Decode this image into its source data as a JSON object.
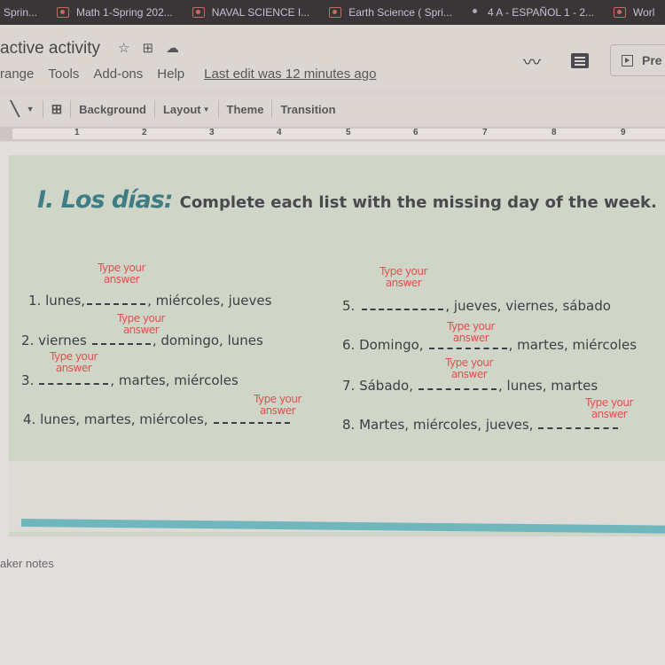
{
  "browser_tabs": [
    {
      "label": "Sprin...",
      "icon": "none"
    },
    {
      "label": "Math 1-Spring 202...",
      "icon": "classroom-icon"
    },
    {
      "label": "NAVAL SCIENCE I...",
      "icon": "classroom-icon"
    },
    {
      "label": "Earth Science ( Spri...",
      "icon": "classroom-icon"
    },
    {
      "label": "4 A - ESPAÑOL 1 - 2...",
      "icon": "person-icon"
    },
    {
      "label": "Worl",
      "icon": "classroom-icon"
    }
  ],
  "document": {
    "title": "active activity",
    "menu": [
      "range",
      "Tools",
      "Add-ons",
      "Help"
    ],
    "last_edit": "Last edit was 12 minutes ago",
    "present_label": "Pre"
  },
  "toolbar": {
    "background": "Background",
    "layout": "Layout",
    "theme": "Theme",
    "transition": "Transition"
  },
  "ruler": [
    "1",
    "2",
    "3",
    "4",
    "5",
    "6",
    "7",
    "8",
    "9"
  ],
  "slide": {
    "title": "I. Los días:",
    "instruction": "Complete each list with the missing day of the week.",
    "hint": "Type your answer",
    "items": [
      {
        "before": "1. lunes,",
        "after": ", miércoles, jueves"
      },
      {
        "before": "2. viernes",
        "after": ", domingo, lunes"
      },
      {
        "before": "3.",
        "after": ", martes, miércoles"
      },
      {
        "before": "4. lunes, martes, miércoles,",
        "after": ""
      },
      {
        "before": "5.",
        "after": ", jueves, viernes, sábado"
      },
      {
        "before": "6. Domingo,",
        "after": ", martes, miércoles"
      },
      {
        "before": "7. Sábado,",
        "after": ", lunes, martes"
      },
      {
        "before": "8. Martes, miércoles, jueves,",
        "after": ""
      }
    ]
  },
  "speaker_notes": "aker notes",
  "colors": {
    "heading_teal": "#3f7d86",
    "hint_red": "#e05050",
    "accent_bar": "#6fb7bc"
  }
}
